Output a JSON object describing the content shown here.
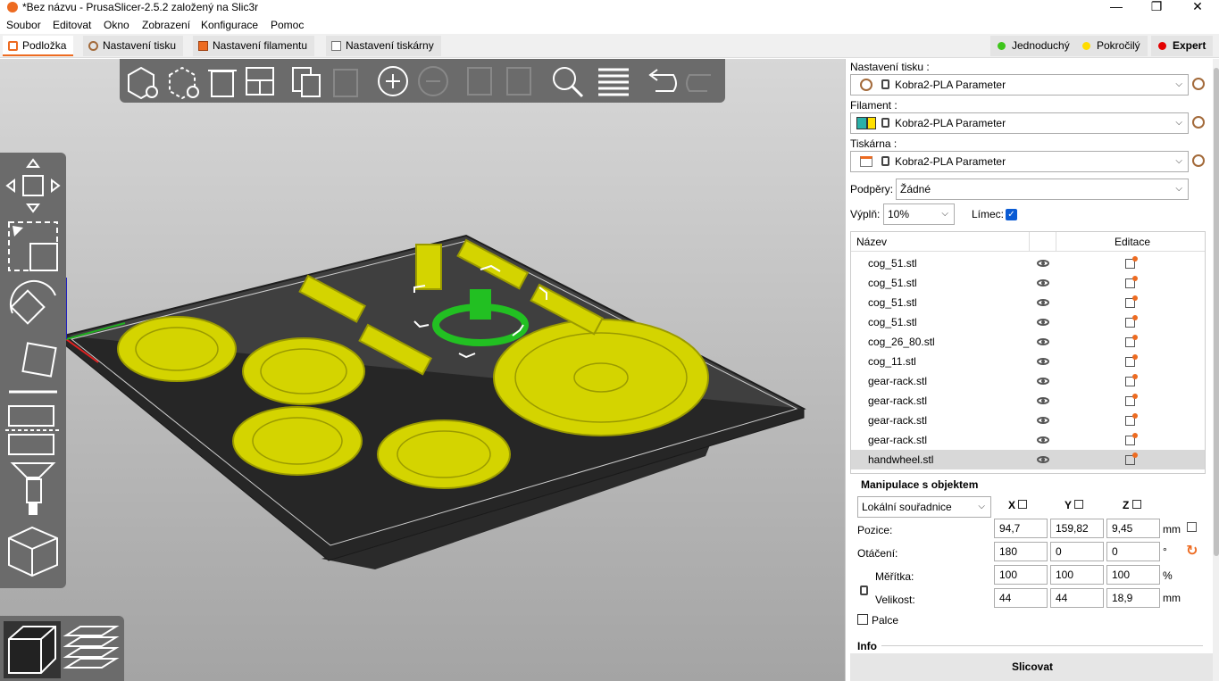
{
  "window": {
    "title": "*Bez názvu - PrusaSlicer-2.5.2 založený na Slic3r",
    "min": "—",
    "max": "❐",
    "close": "✕"
  },
  "menu": [
    "Soubor",
    "Editovat",
    "Okno",
    "Zobrazení",
    "Konfigurace",
    "Pomoc"
  ],
  "tabs": [
    {
      "label": "Podložka",
      "active": true
    },
    {
      "label": "Nastavení tisku"
    },
    {
      "label": "Nastavení filamentu"
    },
    {
      "label": "Nastavení tiskárny"
    }
  ],
  "modes": [
    {
      "label": "Jednoduchý",
      "color": "#3ec51b"
    },
    {
      "label": "Pokročilý",
      "color": "#ffdc00"
    },
    {
      "label": "Expert",
      "color": "#e30000"
    }
  ],
  "accent": "#ed6b21",
  "sidebar": {
    "print_label": "Nastavení tisku :",
    "print_value": "Kobra2-PLA Parameter",
    "filament_label": "Filament :",
    "filament_value": "Kobra2-PLA Parameter",
    "printer_label": "Tiskárna :",
    "printer_value": "Kobra2-PLA Parameter",
    "supports_label": "Podpěry:",
    "supports_value": "Žádné",
    "infill_label": "Výplň:",
    "infill_value": "10%",
    "brim_label": "Límec:",
    "brim_checked": true,
    "list_header_name": "Název",
    "list_header_edit": "Editace",
    "objects": [
      "cog_51.stl",
      "cog_51.stl",
      "cog_51.stl",
      "cog_51.stl",
      "cog_26_80.stl",
      "cog_11.stl",
      "gear-rack.stl",
      "gear-rack.stl",
      "gear-rack.stl",
      "gear-rack.stl",
      "handwheel.stl"
    ],
    "selected_object": "handwheel.stl",
    "manip": {
      "title": "Manipulace s objektem",
      "coords": "Lokální souřadnice",
      "x": "X",
      "y": "Y",
      "z": "Z",
      "pos_label": "Pozice:",
      "pos": [
        "94,7",
        "159,82",
        "9,45"
      ],
      "pos_unit": "mm",
      "rot_label": "Otáčení:",
      "rot": [
        "180",
        "0",
        "0"
      ],
      "rot_unit": "°",
      "scale_label": "Měřítka:",
      "scale": [
        "100",
        "100",
        "100"
      ],
      "scale_unit": "%",
      "size_label": "Velikost:",
      "size": [
        "44",
        "44",
        "18,9"
      ],
      "size_unit": "mm",
      "inches_label": "Palce"
    },
    "info_label": "Info",
    "slice_label": "Slicovat"
  }
}
